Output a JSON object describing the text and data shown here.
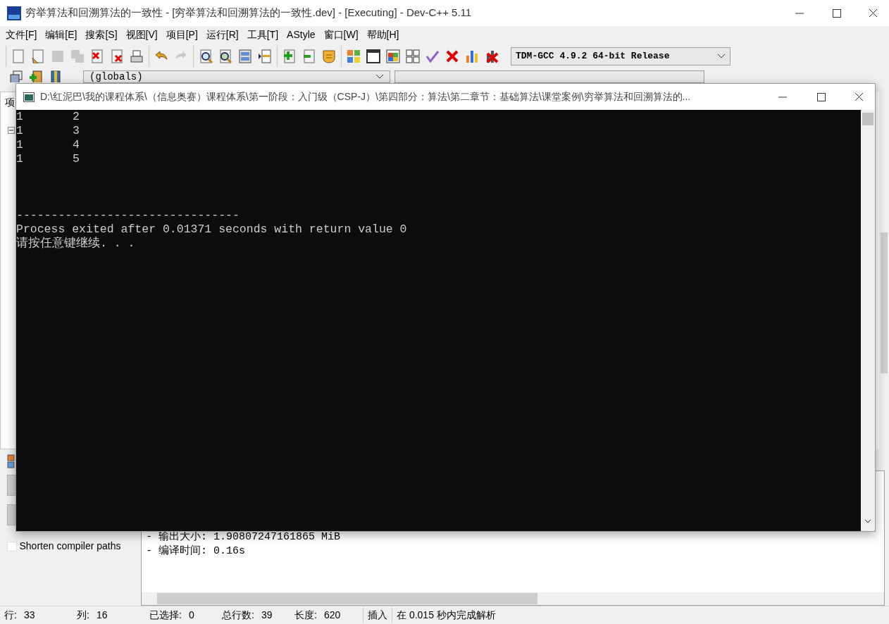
{
  "window": {
    "title": "穷举算法和回溯算法的一致性 - [穷举算法和回溯算法的一致性.dev] - [Executing] - Dev-C++ 5.11"
  },
  "menu": [
    "文件[F]",
    "编辑[E]",
    "搜索[S]",
    "视图[V]",
    "项目[P]",
    "运行[R]",
    "工具[T]",
    "AStyle",
    "窗口[W]",
    "帮助[H]"
  ],
  "toolbar": [
    [
      {
        "kind": "new",
        "disabled": false
      },
      {
        "kind": "open",
        "disabled": false
      },
      {
        "kind": "save",
        "disabled": true
      },
      {
        "kind": "saveall",
        "disabled": true
      },
      {
        "kind": "close",
        "disabled": false
      },
      {
        "kind": "closeall",
        "disabled": false
      },
      {
        "kind": "print",
        "disabled": false
      }
    ],
    [
      {
        "kind": "undo",
        "disabled": false
      },
      {
        "kind": "redo",
        "disabled": true
      }
    ],
    [
      {
        "kind": "find",
        "disabled": false
      },
      {
        "kind": "replace",
        "disabled": false
      },
      {
        "kind": "bookmark",
        "disabled": false
      },
      {
        "kind": "goto",
        "disabled": false
      }
    ],
    [
      {
        "kind": "add",
        "disabled": false
      },
      {
        "kind": "remove",
        "disabled": false
      },
      {
        "kind": "shield",
        "disabled": false
      }
    ],
    [
      {
        "kind": "compile",
        "disabled": false
      },
      {
        "kind": "run",
        "disabled": false
      },
      {
        "kind": "compilerun",
        "disabled": false
      },
      {
        "kind": "rebuild",
        "disabled": false
      },
      {
        "kind": "check",
        "disabled": false
      },
      {
        "kind": "stop",
        "disabled": false
      },
      {
        "kind": "chart",
        "disabled": false
      },
      {
        "kind": "profiledel",
        "disabled": false
      }
    ]
  ],
  "compiler_select": {
    "value": "TDM-GCC 4.9.2 64-bit Release"
  },
  "toolbar2": [
    {
      "kind": "classes"
    },
    {
      "kind": "addclass"
    },
    {
      "kind": "book"
    }
  ],
  "scope_select": {
    "value": "(globals)"
  },
  "left_panel": {
    "tab": "项"
  },
  "bottom_panel": {
    "shorten_paths": {
      "label": "Shorten compiler paths",
      "checked": false
    },
    "log": [
      "- 输出大小: 1.90807247161865 MiB",
      "- 编译时间: 0.16s"
    ]
  },
  "status_bar": [
    {
      "label": "行:",
      "value": "33"
    },
    {
      "label": "列:",
      "value": "16"
    },
    {
      "label": "已选择:",
      "value": "0"
    },
    {
      "label": "总行数:",
      "value": "39"
    },
    {
      "label": "长度:",
      "value": "620"
    },
    {
      "value": "插入"
    },
    {
      "value": "在 0.015 秒内完成解析"
    }
  ],
  "console": {
    "title": "D:\\红泥巴\\我的课程体系\\（信息奥赛）课程体系\\第一阶段：入门级（CSP-J）\\第四部分：算法\\第二章节：基础算法\\课堂案例\\穷举算法和回溯算法的...",
    "rows": [
      {
        "column_1": "1",
        "column_2": "2"
      },
      {
        "column_1": "1",
        "column_2": "3"
      },
      {
        "column_1": "1",
        "column_2": "4"
      },
      {
        "column_1": "1",
        "column_2": "5"
      }
    ],
    "separator": "--------------------------------",
    "message": "Process exited after 0.01371 seconds with return value 0",
    "prompt": "请按任意键继续. . ."
  }
}
